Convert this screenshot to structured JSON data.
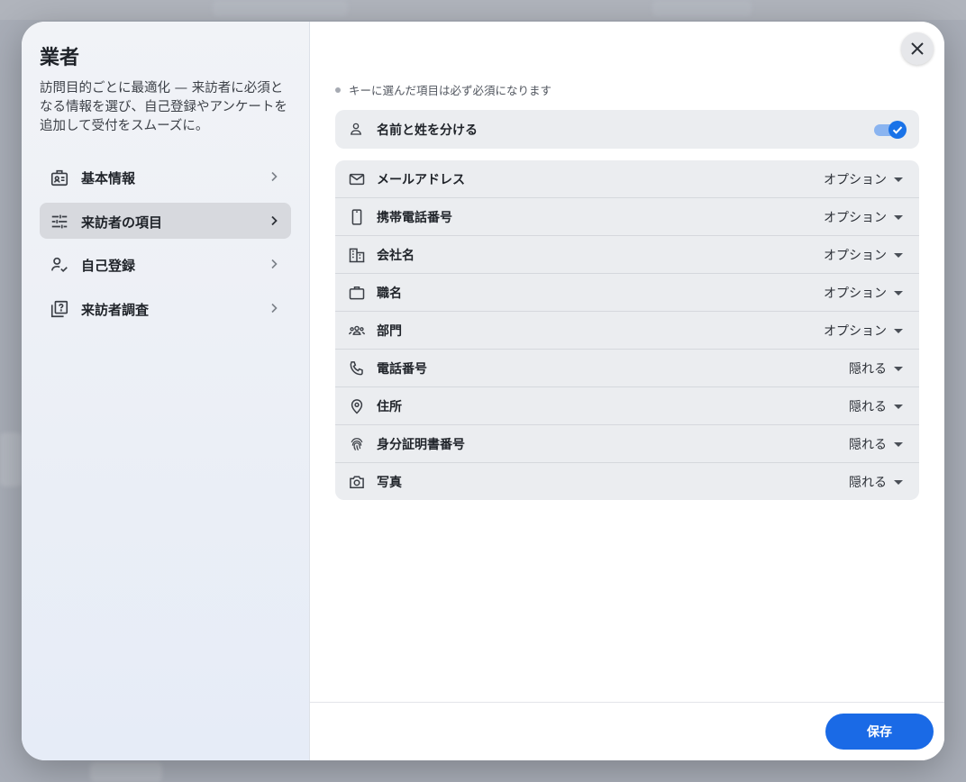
{
  "sidebar": {
    "title": "業者",
    "description": "訪問目的ごとに最適化 — 来訪者に必須となる情報を選び、自己登録やアンケートを追加して受付をスムーズに。",
    "items": [
      {
        "label": "基本情報",
        "icon": "id-badge-icon",
        "active": false
      },
      {
        "label": "来訪者の項目",
        "icon": "sliders-icon",
        "active": true
      },
      {
        "label": "自己登録",
        "icon": "person-check-icon",
        "active": false
      },
      {
        "label": "来訪者調査",
        "icon": "survey-icon",
        "active": false
      }
    ]
  },
  "main": {
    "hint": "キーに選んだ項目は必ず必須になります",
    "split_name": {
      "label": "名前と姓を分ける",
      "icon": "person-icon",
      "enabled": true
    },
    "fields": [
      {
        "label": "メールアドレス",
        "icon": "mail-icon",
        "value": "オプション"
      },
      {
        "label": "携帯電話番号",
        "icon": "smartphone-icon",
        "value": "オプション"
      },
      {
        "label": "会社名",
        "icon": "building-icon",
        "value": "オプション"
      },
      {
        "label": "職名",
        "icon": "briefcase-icon",
        "value": "オプション"
      },
      {
        "label": "部門",
        "icon": "group-icon",
        "value": "オプション"
      },
      {
        "label": "電話番号",
        "icon": "phone-icon",
        "value": "隠れる"
      },
      {
        "label": "住所",
        "icon": "location-pin-icon",
        "value": "隠れる"
      },
      {
        "label": "身分証明書番号",
        "icon": "fingerprint-icon",
        "value": "隠れる"
      },
      {
        "label": "写真",
        "icon": "camera-icon",
        "value": "隠れる"
      }
    ],
    "save_label": "保存"
  },
  "colors": {
    "accent": "#1a6ae6",
    "toggle_on": "#1a73e8",
    "active_nav": "#d7d9de"
  }
}
